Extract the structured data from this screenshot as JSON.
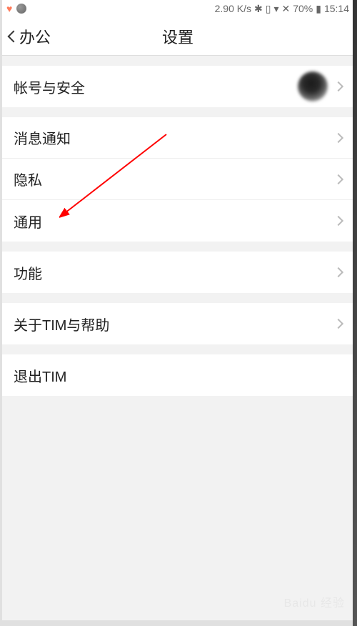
{
  "status": {
    "speed": "2.90 K/s",
    "battery": "70%",
    "time": "15:14"
  },
  "nav": {
    "back_label": "办公",
    "title": "设置"
  },
  "groups": [
    {
      "rows": [
        {
          "label": "帐号与安全",
          "avatar": true,
          "chevron": true
        }
      ]
    },
    {
      "rows": [
        {
          "label": "消息通知",
          "chevron": true
        },
        {
          "label": "隐私",
          "chevron": true
        },
        {
          "label": "通用",
          "chevron": true
        }
      ]
    },
    {
      "rows": [
        {
          "label": "功能",
          "chevron": true
        }
      ]
    },
    {
      "rows": [
        {
          "label": "关于TIM与帮助",
          "chevron": true
        }
      ]
    },
    {
      "rows": [
        {
          "label": "退出TIM",
          "chevron": false
        }
      ]
    }
  ],
  "watermark": "Baidu 经验"
}
